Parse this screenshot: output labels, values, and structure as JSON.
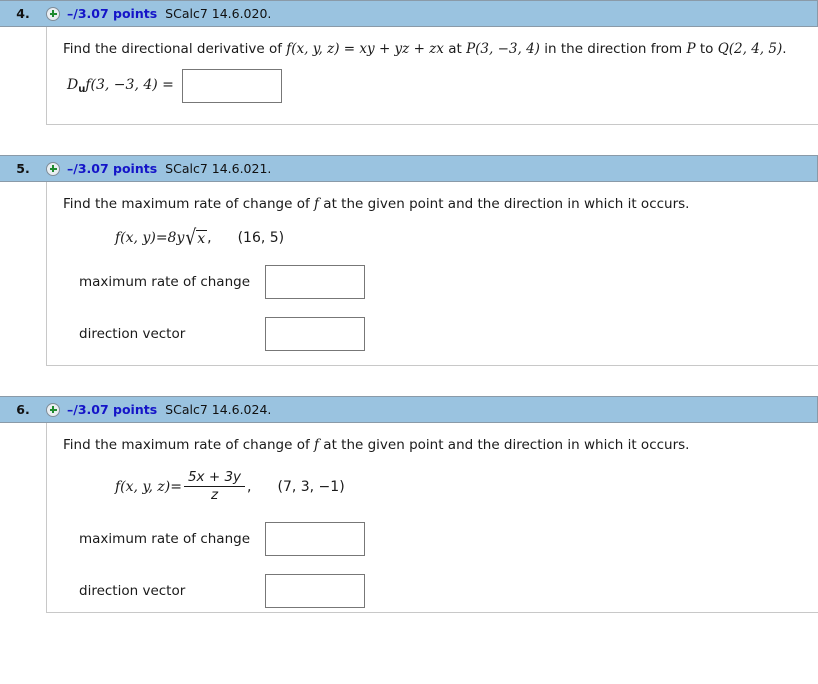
{
  "icons": {
    "expand": "plus-circle-icon"
  },
  "colors": {
    "header_bg": "#9ac3e0",
    "points_text": "#1414c8",
    "plus_green": "#1f8a2f",
    "border_gray": "#c8c8c8",
    "input_border": "#777777"
  },
  "questions": [
    {
      "number": "4.",
      "points": "–/3.07 points",
      "reference": "SCalc7 14.6.020.",
      "prompt_parts": {
        "p1": "Find the directional derivative of ",
        "fn": "f(x, y, z)",
        "p2": " = ",
        "expr": "xy + yz + zx",
        "p3": " at ",
        "point1": "P(3, −3, 4)",
        "p4": " in the direction from ",
        "pointP": "P",
        "p5": " to ",
        "pointQ": "Q(2, 4, 5)",
        "p6": "."
      },
      "answer_label_D": "D",
      "answer_label_sub": "u",
      "answer_label_rest": "f(3, −3, 4) =",
      "answer_value": "",
      "answer_placeholder": ""
    },
    {
      "number": "5.",
      "points": "–/3.07 points",
      "reference": "SCalc7 14.6.021.",
      "prompt": "Find the maximum rate of change of f at the given point and the direction in which it occurs.",
      "prompt_parts": {
        "a": "Find the maximum rate of change of ",
        "f": "f",
        "b": " at the given point and the direction in which it occurs."
      },
      "function": {
        "lhs": "f(x, y)",
        "eq": " = ",
        "coef": "8y",
        "radicand": "x",
        "comma": ",",
        "point": "(16, 5)"
      },
      "fields": [
        {
          "label": "maximum rate of change",
          "value": "",
          "placeholder": ""
        },
        {
          "label": "direction vector",
          "value": "",
          "placeholder": ""
        }
      ]
    },
    {
      "number": "6.",
      "points": "–/3.07 points",
      "reference": "SCalc7 14.6.024.",
      "prompt": "Find the maximum rate of change of f at the given point and the direction in which it occurs.",
      "prompt_parts": {
        "a": "Find the maximum rate of change of ",
        "f": "f",
        "b": " at the given point and the direction in which it occurs."
      },
      "function": {
        "lhs": "f(x, y, z)",
        "eq": " = ",
        "numerator": "5x + 3y",
        "denominator": "z",
        "comma": ",",
        "point": "(7, 3, −1)"
      },
      "fields": [
        {
          "label": "maximum rate of change",
          "value": "",
          "placeholder": ""
        },
        {
          "label": "direction vector",
          "value": "",
          "placeholder": ""
        }
      ]
    }
  ]
}
